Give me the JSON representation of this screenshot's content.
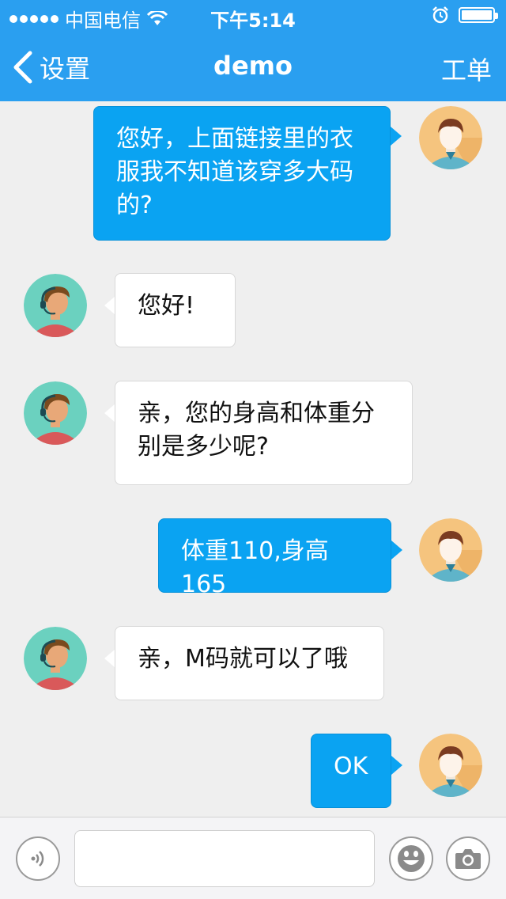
{
  "status_bar": {
    "carrier": "中国电信",
    "time": "下午5:14"
  },
  "nav": {
    "back_label": "设置",
    "title": "demo",
    "right_label": "工单"
  },
  "messages": [
    {
      "sender": "me",
      "lines": [
        "您好，上面链接里的衣",
        "服我不知道该穿多大码",
        "的?"
      ]
    },
    {
      "sender": "agent",
      "lines": [
        "您好!"
      ]
    },
    {
      "sender": "agent",
      "lines": [
        "亲，您的身高和体重分",
        "别是多少呢?"
      ]
    },
    {
      "sender": "me",
      "lines": [
        "体重110,身高165"
      ]
    },
    {
      "sender": "agent",
      "lines": [
        "亲，M码就可以了哦"
      ]
    },
    {
      "sender": "me",
      "lines": [
        "OK"
      ]
    }
  ],
  "input": {
    "placeholder": ""
  },
  "colors": {
    "header": "#2a9ff0",
    "my_bubble": "#0aa3f2",
    "their_bubble": "#ffffff",
    "background": "#efefef"
  },
  "icons": {
    "back": "chevron-left-icon",
    "wifi": "wifi-icon",
    "alarm": "alarm-icon",
    "battery": "battery-icon",
    "voice": "voice-icon",
    "emoji": "emoji-icon",
    "camera": "camera-icon"
  }
}
